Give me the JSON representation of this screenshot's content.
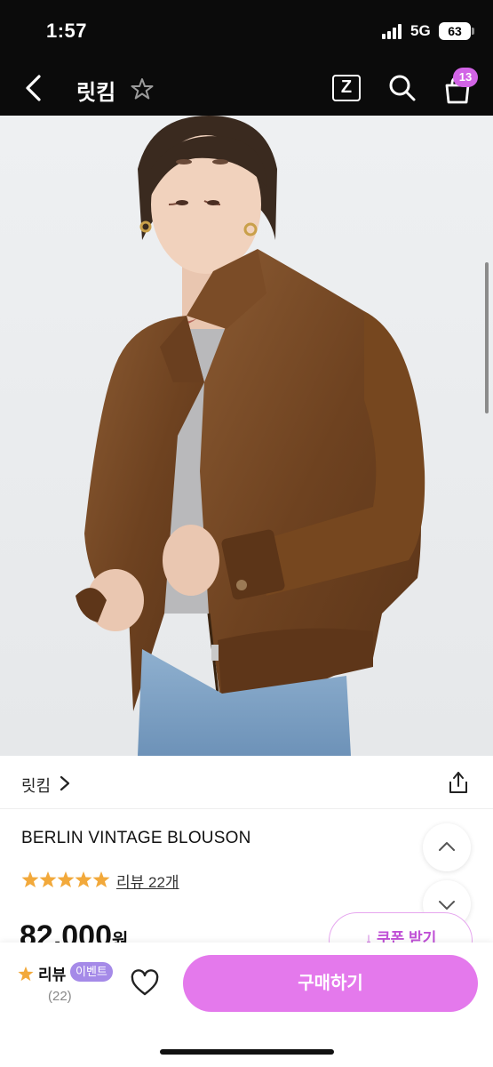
{
  "status_bar": {
    "time": "1:57",
    "network": "5G",
    "battery": "63"
  },
  "nav": {
    "title": "릿킴",
    "z_label": "Z",
    "cart_count": "13"
  },
  "product": {
    "brand": "릿킴",
    "name": "BERLIN VINTAGE BLOUSON",
    "rating_stars": 5,
    "review_link": "리뷰 22개",
    "price": "82,000",
    "price_unit": "원",
    "coupon_label": "↓ 쿠폰 받기"
  },
  "bottom_bar": {
    "review_label": "리뷰",
    "event_badge": "이벤트",
    "review_count": "(22)",
    "buy_label": "구매하기"
  },
  "colors": {
    "accent": "#e479ec",
    "badge": "#d264e6",
    "event": "#a58ae8",
    "star": "#f2a93b"
  }
}
